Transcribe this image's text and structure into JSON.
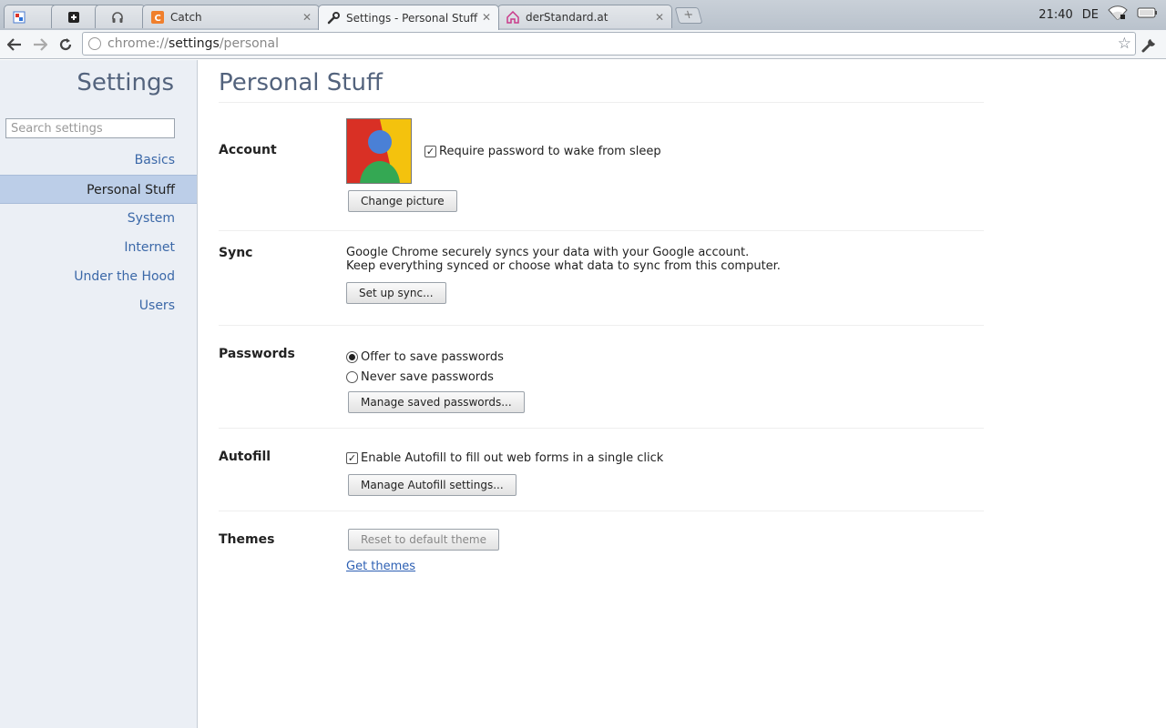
{
  "tabs": [
    {
      "title": "",
      "icon": "google-apps-icon"
    },
    {
      "title": "",
      "icon": "plus-square-icon"
    },
    {
      "title": "",
      "icon": "headphones-icon"
    },
    {
      "title": "Catch",
      "icon": "catch-icon"
    },
    {
      "title": "Settings - Personal Stuff",
      "icon": "wrench-icon",
      "active": true
    },
    {
      "title": "derStandard.at",
      "icon": "house-icon"
    }
  ],
  "status": {
    "time": "21:40",
    "lang": "DE"
  },
  "omnibox": {
    "scheme": "chrome://",
    "host": "settings",
    "path": "/personal"
  },
  "sidebar": {
    "title": "Settings",
    "search_placeholder": "Search settings",
    "items": [
      {
        "label": "Basics"
      },
      {
        "label": "Personal Stuff",
        "selected": true
      },
      {
        "label": "System"
      },
      {
        "label": "Internet"
      },
      {
        "label": "Under the Hood"
      },
      {
        "label": "Users"
      }
    ]
  },
  "main": {
    "title": "Personal Stuff",
    "account": {
      "label": "Account",
      "require_password": "Require password to wake from sleep",
      "require_password_checked": true,
      "change_picture": "Change picture"
    },
    "sync": {
      "label": "Sync",
      "line1": "Google Chrome securely syncs your data with your Google account.",
      "line2": "Keep everything synced or choose what data to sync from this computer.",
      "button": "Set up sync..."
    },
    "passwords": {
      "label": "Passwords",
      "offer": "Offer to save passwords",
      "never": "Never save passwords",
      "selected": "offer",
      "button": "Manage saved passwords..."
    },
    "autofill": {
      "label": "Autofill",
      "enable": "Enable Autofill to fill out web forms in a single click",
      "enabled": true,
      "button": "Manage Autofill settings..."
    },
    "themes": {
      "label": "Themes",
      "reset": "Reset to default theme",
      "get": "Get themes"
    }
  },
  "colors": {
    "accent": "#53637d",
    "selected_nav": "#bccee8",
    "link": "#2c5fb3"
  }
}
